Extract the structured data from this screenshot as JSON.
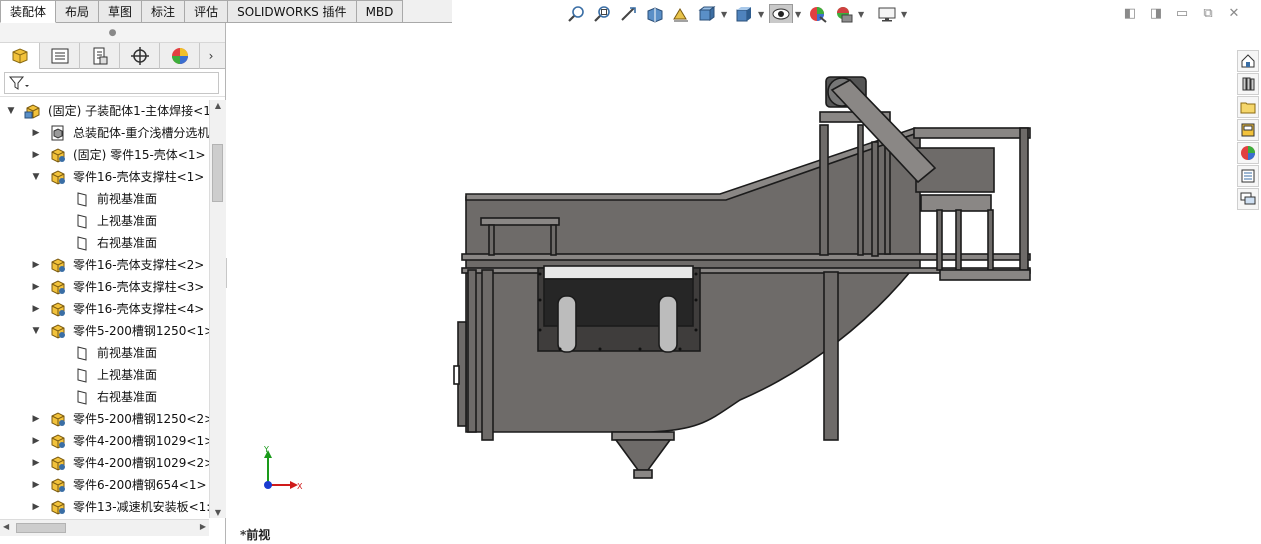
{
  "command_tabs": [
    {
      "label": "装配体",
      "active": true
    },
    {
      "label": "布局",
      "active": false
    },
    {
      "label": "草图",
      "active": false
    },
    {
      "label": "标注",
      "active": false
    },
    {
      "label": "评估",
      "active": false
    },
    {
      "label": "SOLIDWORKS 插件",
      "active": false
    },
    {
      "label": "MBD",
      "active": false
    }
  ],
  "hud_toolbar": [
    "zoom-to-fit-icon",
    "zoom-to-area-icon",
    "previous-view-icon",
    "section-view-icon",
    "dynamic-annotation-icon",
    "view-orientation-icon",
    "display-style-icon",
    "hide-show-items-icon",
    "edit-appearance-icon",
    "apply-scene-icon",
    "view-settings-icon"
  ],
  "manager_tabs": [
    "feature-manager-icon",
    "property-manager-icon",
    "configuration-manager-icon",
    "dimxpert-manager-icon",
    "display-manager-icon"
  ],
  "tree": [
    {
      "label": "(固定) 子装配体1-主体焊接<1",
      "depth": 0,
      "expander": "open",
      "icon": "subassembly",
      "trail": "^"
    },
    {
      "label": "总装配体-重介浅槽分选机",
      "depth": 1,
      "expander": "closed",
      "icon": "assembly-file",
      "trail": ""
    },
    {
      "label": "(固定) 零件15-壳体<1> (",
      "depth": 1,
      "expander": "closed",
      "icon": "part",
      "trail": ""
    },
    {
      "label": "零件16-壳体支撑柱<1> (",
      "depth": 1,
      "expander": "open",
      "icon": "part",
      "trail": ""
    },
    {
      "label": "前视基准面",
      "depth": 2,
      "expander": "none",
      "icon": "plane",
      "trail": ""
    },
    {
      "label": "上视基准面",
      "depth": 2,
      "expander": "none",
      "icon": "plane",
      "trail": ""
    },
    {
      "label": "右视基准面",
      "depth": 2,
      "expander": "none",
      "icon": "plane",
      "trail": ""
    },
    {
      "label": "零件16-壳体支撑柱<2> (",
      "depth": 1,
      "expander": "closed",
      "icon": "part",
      "trail": ""
    },
    {
      "label": "零件16-壳体支撑柱<3> (",
      "depth": 1,
      "expander": "closed",
      "icon": "part",
      "trail": ""
    },
    {
      "label": "零件16-壳体支撑柱<4> (",
      "depth": 1,
      "expander": "closed",
      "icon": "part",
      "trail": ""
    },
    {
      "label": "零件5-200槽钢1250<1>",
      "depth": 1,
      "expander": "open",
      "icon": "part",
      "trail": ""
    },
    {
      "label": "前视基准面",
      "depth": 2,
      "expander": "none",
      "icon": "plane",
      "trail": ""
    },
    {
      "label": "上视基准面",
      "depth": 2,
      "expander": "none",
      "icon": "plane",
      "trail": ""
    },
    {
      "label": "右视基准面",
      "depth": 2,
      "expander": "none",
      "icon": "plane",
      "trail": ""
    },
    {
      "label": "零件5-200槽钢1250<2>",
      "depth": 1,
      "expander": "closed",
      "icon": "part",
      "trail": ""
    },
    {
      "label": "零件4-200槽钢1029<1>",
      "depth": 1,
      "expander": "closed",
      "icon": "part",
      "trail": ""
    },
    {
      "label": "零件4-200槽钢1029<2>",
      "depth": 1,
      "expander": "closed",
      "icon": "part",
      "trail": ""
    },
    {
      "label": "零件6-200槽钢654<1> (",
      "depth": 1,
      "expander": "closed",
      "icon": "part",
      "trail": ""
    },
    {
      "label": "零件13-减速机安装板<1:",
      "depth": 1,
      "expander": "closed",
      "icon": "part",
      "trail": ""
    }
  ],
  "triad": {
    "y_label": "Y",
    "x_label": "X"
  },
  "view_name": "*前视",
  "task_pane": [
    "solidworks-resources-icon",
    "design-library-icon",
    "file-explorer-icon",
    "view-palette-icon",
    "appearances-icon",
    "custom-properties-icon",
    "forum-icon"
  ],
  "colors": {
    "model_fill": "#6e6b69",
    "model_edge": "#1b1b1b",
    "viewport_bg": "#ffffff",
    "tab_border": "#a9a9a9"
  }
}
